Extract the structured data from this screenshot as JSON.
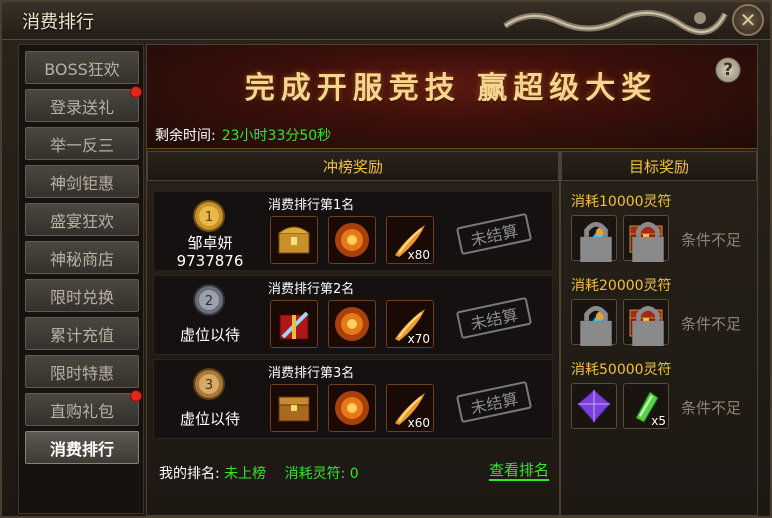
{
  "window": {
    "title": "消费排行",
    "close_icon": "✕"
  },
  "sidebar": {
    "items": [
      {
        "label": "BOSS狂欢",
        "badge": false,
        "active": false
      },
      {
        "label": "登录送礼",
        "badge": true,
        "active": false
      },
      {
        "label": "举一反三",
        "badge": false,
        "active": false
      },
      {
        "label": "神剑钜惠",
        "badge": false,
        "active": false
      },
      {
        "label": "盛宴狂欢",
        "badge": false,
        "active": false
      },
      {
        "label": "神秘商店",
        "badge": false,
        "active": false
      },
      {
        "label": "限时兑换",
        "badge": false,
        "active": false
      },
      {
        "label": "累计充值",
        "badge": false,
        "active": false
      },
      {
        "label": "限时特惠",
        "badge": false,
        "active": false
      },
      {
        "label": "直购礼包",
        "badge": true,
        "active": false
      },
      {
        "label": "消费排行",
        "badge": false,
        "active": true
      }
    ]
  },
  "banner": {
    "text": "完成开服竞技  赢超级大奖",
    "help": "?"
  },
  "remain": {
    "label": "剩余时间:",
    "value": "23小时33分50秒"
  },
  "headers": {
    "rank": "冲榜奖励",
    "target": "目标奖励"
  },
  "ranks": [
    {
      "title": "消费排行第1名",
      "medal": "1",
      "name": "邹卓妍",
      "score": "9737876",
      "count": "x80",
      "status": "未结算"
    },
    {
      "title": "消费排行第2名",
      "medal": "2",
      "name": "虚位以待",
      "score": "",
      "count": "x70",
      "status": "未结算"
    },
    {
      "title": "消费排行第3名",
      "medal": "3",
      "name": "虚位以待",
      "score": "",
      "count": "x60",
      "status": "未结算"
    }
  ],
  "targets": [
    {
      "title": "消耗10000灵符",
      "condition": "条件不足",
      "count": ""
    },
    {
      "title": "消耗20000灵符",
      "condition": "条件不足",
      "count": ""
    },
    {
      "title": "消耗50000灵符",
      "condition": "条件不足",
      "count": "x5"
    }
  ],
  "footer": {
    "my_rank_label": "我的排名:",
    "my_rank_value": "未上榜",
    "consume_label": "消耗灵符:",
    "consume_value": "0",
    "view_link": "查看排名"
  },
  "colors": {
    "accent_gold": "#f0c23a",
    "green": "#2ee82a",
    "badge_red": "#e2261c"
  }
}
